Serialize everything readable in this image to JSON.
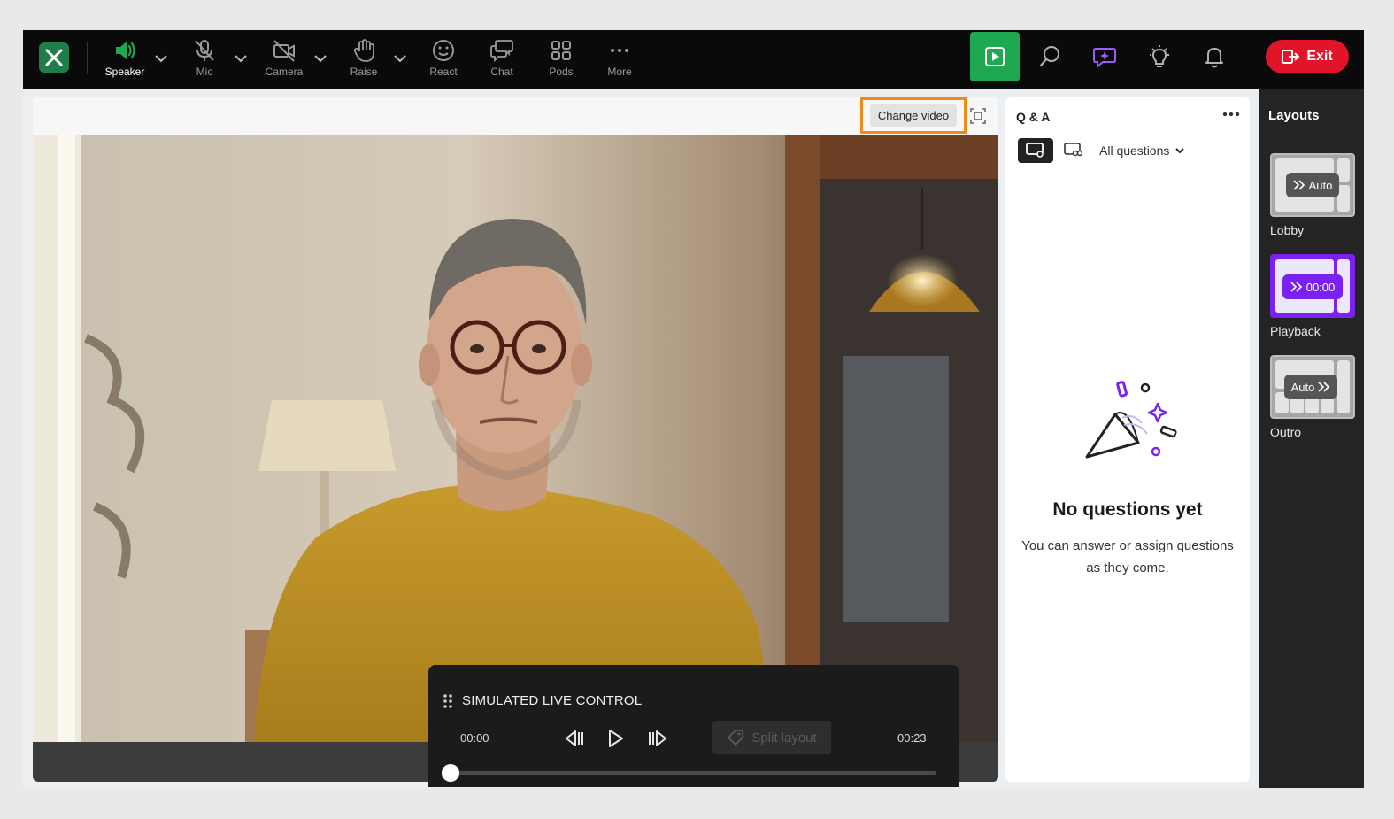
{
  "toolbar": {
    "items": [
      {
        "label": "Speaker",
        "icon": "speaker-icon"
      },
      {
        "label": "Mic",
        "icon": "mic-off-icon"
      },
      {
        "label": "Camera",
        "icon": "camera-off-icon"
      },
      {
        "label": "Raise",
        "icon": "hand-icon"
      },
      {
        "label": "React",
        "icon": "smile-icon"
      },
      {
        "label": "Chat",
        "icon": "chat-icon"
      },
      {
        "label": "Pods",
        "icon": "grid-icon"
      },
      {
        "label": "More",
        "icon": "more-icon"
      }
    ],
    "exit_label": "Exit",
    "colors": {
      "active_green": "#1ea852",
      "exit_red": "#e3142a",
      "accent_purple": "#7b22f2"
    }
  },
  "stage": {
    "change_video_label": "Change video"
  },
  "live_control": {
    "title": "SIMULATED LIVE CONTROL",
    "time_start": "00:00",
    "time_end": "00:23",
    "split_layout_label": "Split layout",
    "progress": 0.0
  },
  "qa": {
    "title": "Q & A",
    "filter_label": "All questions",
    "empty_title": "No questions yet",
    "empty_text": "You can answer or assign questions as they come."
  },
  "layouts": {
    "title": "Layouts",
    "items": [
      {
        "label": "Lobby",
        "badge": "Auto"
      },
      {
        "label": "Playback",
        "badge": "00:00"
      },
      {
        "label": "Outro",
        "badge": "Auto"
      }
    ]
  }
}
